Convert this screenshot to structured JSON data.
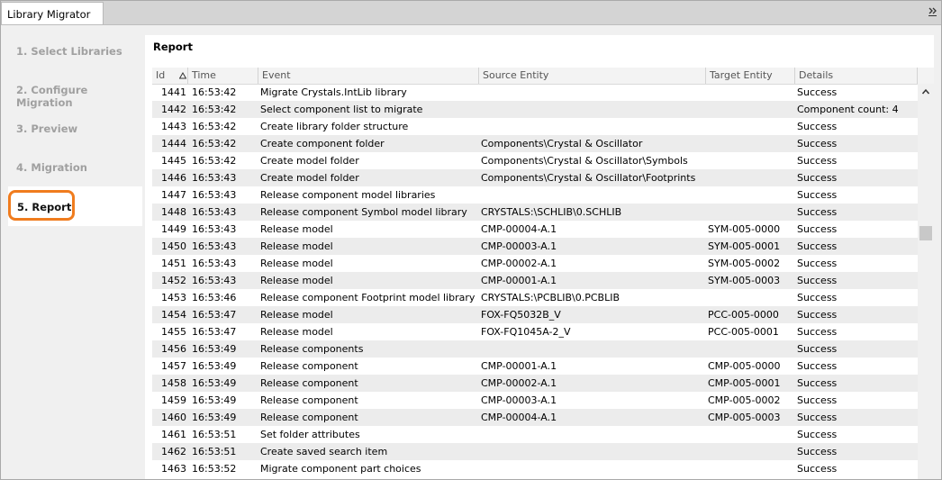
{
  "window": {
    "tab_title": "Library Migrator",
    "overflow_icon": "double-chevron-right-icon"
  },
  "sidebar": {
    "steps": [
      {
        "label": "1. Select Libraries"
      },
      {
        "label": "2. Configure Migration"
      },
      {
        "label": "3. Preview"
      },
      {
        "label": "4. Migration"
      },
      {
        "label": "5. Report"
      }
    ],
    "active_step": "5. Report",
    "accent_color": "#f07c1e"
  },
  "report": {
    "title": "Report",
    "columns": {
      "id": "Id",
      "time": "Time",
      "event": "Event",
      "source": "Source Entity",
      "target": "Target Entity",
      "details": "Details"
    },
    "sort_icon": "sort-ascending-triangle-icon",
    "rows": [
      {
        "id": "1441",
        "time": "16:53:42",
        "event": "Migrate Crystals.IntLib library",
        "source": "",
        "target": "",
        "details": "Success"
      },
      {
        "id": "1442",
        "time": "16:53:42",
        "event": "Select component list to migrate",
        "source": "",
        "target": "",
        "details": "Component count: 4"
      },
      {
        "id": "1443",
        "time": "16:53:42",
        "event": "Create library folder structure",
        "source": "",
        "target": "",
        "details": "Success"
      },
      {
        "id": "1444",
        "time": "16:53:42",
        "event": "Create component folder",
        "source": "Components\\Crystal & Oscillator",
        "target": "",
        "details": "Success"
      },
      {
        "id": "1445",
        "time": "16:53:42",
        "event": "Create model folder",
        "source": "Components\\Crystal & Oscillator\\Symbols",
        "target": "",
        "details": "Success"
      },
      {
        "id": "1446",
        "time": "16:53:43",
        "event": "Create model folder",
        "source": "Components\\Crystal & Oscillator\\Footprints",
        "target": "",
        "details": "Success"
      },
      {
        "id": "1447",
        "time": "16:53:43",
        "event": "Release component model libraries",
        "source": "",
        "target": "",
        "details": "Success"
      },
      {
        "id": "1448",
        "time": "16:53:43",
        "event": "Release component Symbol model library",
        "source": "CRYSTALS:\\SCHLIB\\0.SCHLIB",
        "target": "",
        "details": "Success"
      },
      {
        "id": "1449",
        "time": "16:53:43",
        "event": "Release model",
        "source": "CMP-00004-A.1",
        "target": "SYM-005-0000",
        "details": "Success"
      },
      {
        "id": "1450",
        "time": "16:53:43",
        "event": "Release model",
        "source": "CMP-00003-A.1",
        "target": "SYM-005-0001",
        "details": "Success"
      },
      {
        "id": "1451",
        "time": "16:53:43",
        "event": "Release model",
        "source": "CMP-00002-A.1",
        "target": "SYM-005-0002",
        "details": "Success"
      },
      {
        "id": "1452",
        "time": "16:53:43",
        "event": "Release model",
        "source": "CMP-00001-A.1",
        "target": "SYM-005-0003",
        "details": "Success"
      },
      {
        "id": "1453",
        "time": "16:53:46",
        "event": "Release component Footprint model library",
        "source": "CRYSTALS:\\PCBLIB\\0.PCBLIB",
        "target": "",
        "details": "Success"
      },
      {
        "id": "1454",
        "time": "16:53:47",
        "event": "Release model",
        "source": "FOX-FQ5032B_V",
        "target": "PCC-005-0000",
        "details": "Success"
      },
      {
        "id": "1455",
        "time": "16:53:47",
        "event": "Release model",
        "source": "FOX-FQ1045A-2_V",
        "target": "PCC-005-0001",
        "details": "Success"
      },
      {
        "id": "1456",
        "time": "16:53:49",
        "event": "Release components",
        "source": "",
        "target": "",
        "details": "Success"
      },
      {
        "id": "1457",
        "time": "16:53:49",
        "event": "Release component",
        "source": "CMP-00001-A.1",
        "target": "CMP-005-0000",
        "details": "Success"
      },
      {
        "id": "1458",
        "time": "16:53:49",
        "event": "Release component",
        "source": "CMP-00002-A.1",
        "target": "CMP-005-0001",
        "details": "Success"
      },
      {
        "id": "1459",
        "time": "16:53:49",
        "event": "Release component",
        "source": "CMP-00003-A.1",
        "target": "CMP-005-0002",
        "details": "Success"
      },
      {
        "id": "1460",
        "time": "16:53:49",
        "event": "Release component",
        "source": "CMP-00004-A.1",
        "target": "CMP-005-0003",
        "details": "Success"
      },
      {
        "id": "1461",
        "time": "16:53:51",
        "event": "Set folder attributes",
        "source": "",
        "target": "",
        "details": "Success"
      },
      {
        "id": "1462",
        "time": "16:53:51",
        "event": "Create saved search item",
        "source": "",
        "target": "",
        "details": "Success"
      },
      {
        "id": "1463",
        "time": "16:53:52",
        "event": "Migrate component part choices",
        "source": "",
        "target": "",
        "details": "Success"
      }
    ]
  }
}
